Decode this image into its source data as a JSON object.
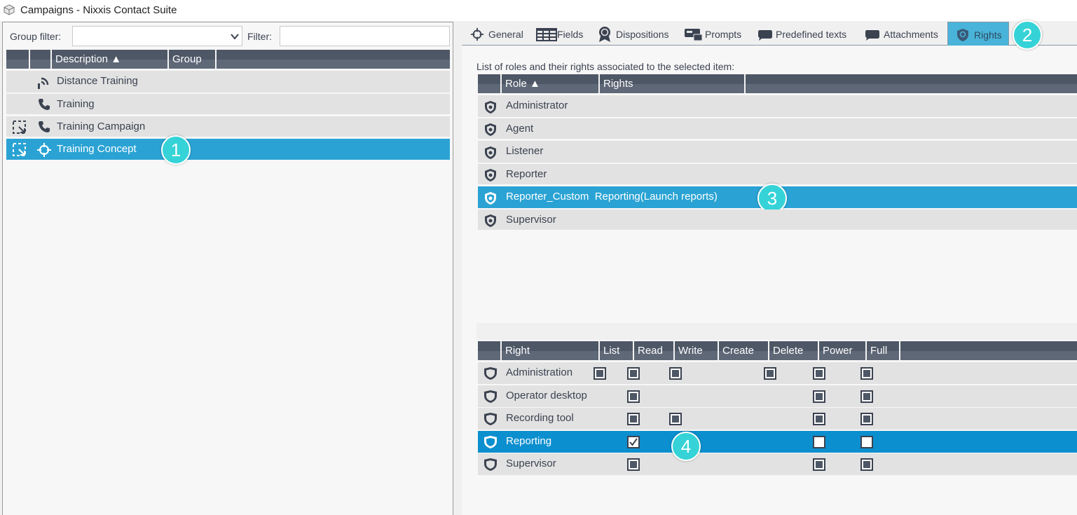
{
  "window": {
    "title": "Campaigns - Nixxis Contact Suite"
  },
  "left": {
    "group_filter_label": "Group filter:",
    "group_filter_value": "",
    "filter_label": "Filter:",
    "filter_value": "",
    "columns": [
      "Description ▲",
      "Group"
    ],
    "rows": [
      {
        "label": "Distance Training",
        "icon": "broadcast-icon",
        "selected": false
      },
      {
        "label": "Training",
        "icon": "phone-icon",
        "selected": false
      },
      {
        "label": "Training Campaign",
        "icon": "phone-icon",
        "selected": false
      },
      {
        "label": "Training Concept",
        "icon": "crosshair-icon",
        "selected": true
      }
    ]
  },
  "tabs": [
    "General",
    "Fields",
    "Dispositions",
    "Prompts",
    "Predefined texts",
    "Attachments",
    "Rights"
  ],
  "active_tab": "Rights",
  "roles": {
    "caption": "List of roles and their rights associated to the selected item:",
    "columns": [
      "Role ▲",
      "Rights"
    ],
    "rows": [
      "Administrator",
      "Agent",
      "Listener",
      "Reporter",
      "Reporter_Custom  Reporting(Launch reports)",
      "Supervisor"
    ],
    "selected": "Reporter_Custom  Reporting(Launch reports)"
  },
  "rights": {
    "columns": [
      "Right",
      "List",
      "Read",
      "Write",
      "Create",
      "Delete",
      "Power",
      "Full"
    ],
    "rows": [
      {
        "label": "Administration",
        "checks": [
          "filled",
          "filled",
          "filled",
          "none",
          "filled",
          "filled",
          "filled"
        ]
      },
      {
        "label": "Operator desktop",
        "checks": [
          "none",
          "filled",
          "none",
          "none",
          "none",
          "filled",
          "filled"
        ]
      },
      {
        "label": "Recording tool",
        "checks": [
          "none",
          "filled",
          "filled",
          "none",
          "none",
          "filled",
          "filled"
        ]
      },
      {
        "label": "Reporting",
        "checks": [
          "none",
          "checked",
          "none",
          "none",
          "none",
          "empty",
          "empty"
        ]
      },
      {
        "label": "Supervisor",
        "checks": [
          "none",
          "filled",
          "none",
          "none",
          "none",
          "filled",
          "filled"
        ]
      }
    ],
    "selected": "Reporting"
  },
  "badges": [
    "1",
    "2",
    "3",
    "4"
  ],
  "colors": {
    "accent": "#2aa3d4",
    "header": "#4e5766",
    "badge": "#35d3d7"
  }
}
